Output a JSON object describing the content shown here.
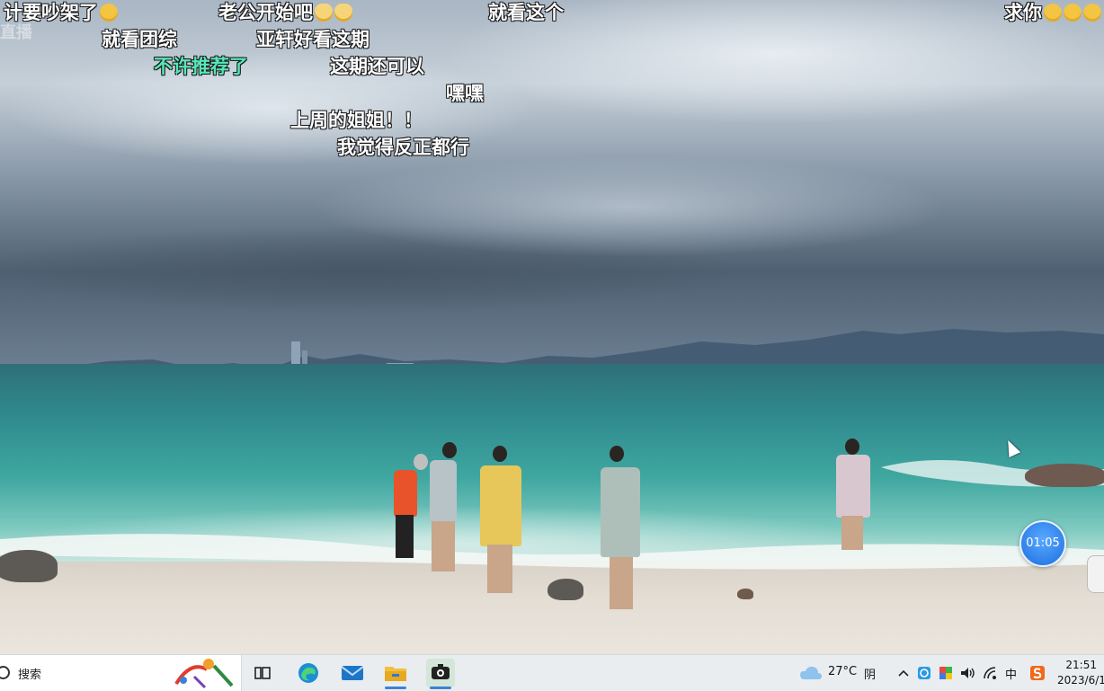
{
  "danmaku": [
    {
      "text": "计要吵架了",
      "emoji": 1,
      "emoji_type": "smile"
    },
    {
      "text": "老公开始吧",
      "emoji": 2,
      "emoji_type": "cat"
    },
    {
      "text": "就看这个"
    },
    {
      "text": "求你",
      "emoji": 3,
      "emoji_type": "sad"
    },
    {
      "text": "就看团综"
    },
    {
      "text": "亚轩好看这期"
    },
    {
      "text": "不许推荐了",
      "color": "#57e6b8"
    },
    {
      "text": "这期还可以"
    },
    {
      "text": "嘿嘿"
    },
    {
      "text": "上周的姐姐！！"
    },
    {
      "text": "我觉得反正都行"
    }
  ],
  "watermark": "直播",
  "player": {
    "timer": "01:05"
  },
  "taskbar": {
    "search_placeholder": "搜索",
    "icons": [
      "task-view-icon",
      "edge-icon",
      "mail-icon",
      "file-explorer-icon",
      "screen-recorder-icon"
    ],
    "weather": {
      "temp": "27°C",
      "condition": "阴",
      "icon": "cloud-icon"
    },
    "tray_icons": [
      "chevron-up-icon",
      "shield-icon",
      "color-picker-icon",
      "volume-icon",
      "wifi-icon",
      "ime-icon",
      "sogou-icon"
    ],
    "ime_label": "中",
    "clock_time": "21:51",
    "clock_date": "2023/6/1"
  },
  "colors": {
    "taskbar_bg": "#e9edf0",
    "accent": "#3b82d6",
    "danmaku_green": "#57e6b8",
    "timer_blue": "#1b6fe0"
  }
}
